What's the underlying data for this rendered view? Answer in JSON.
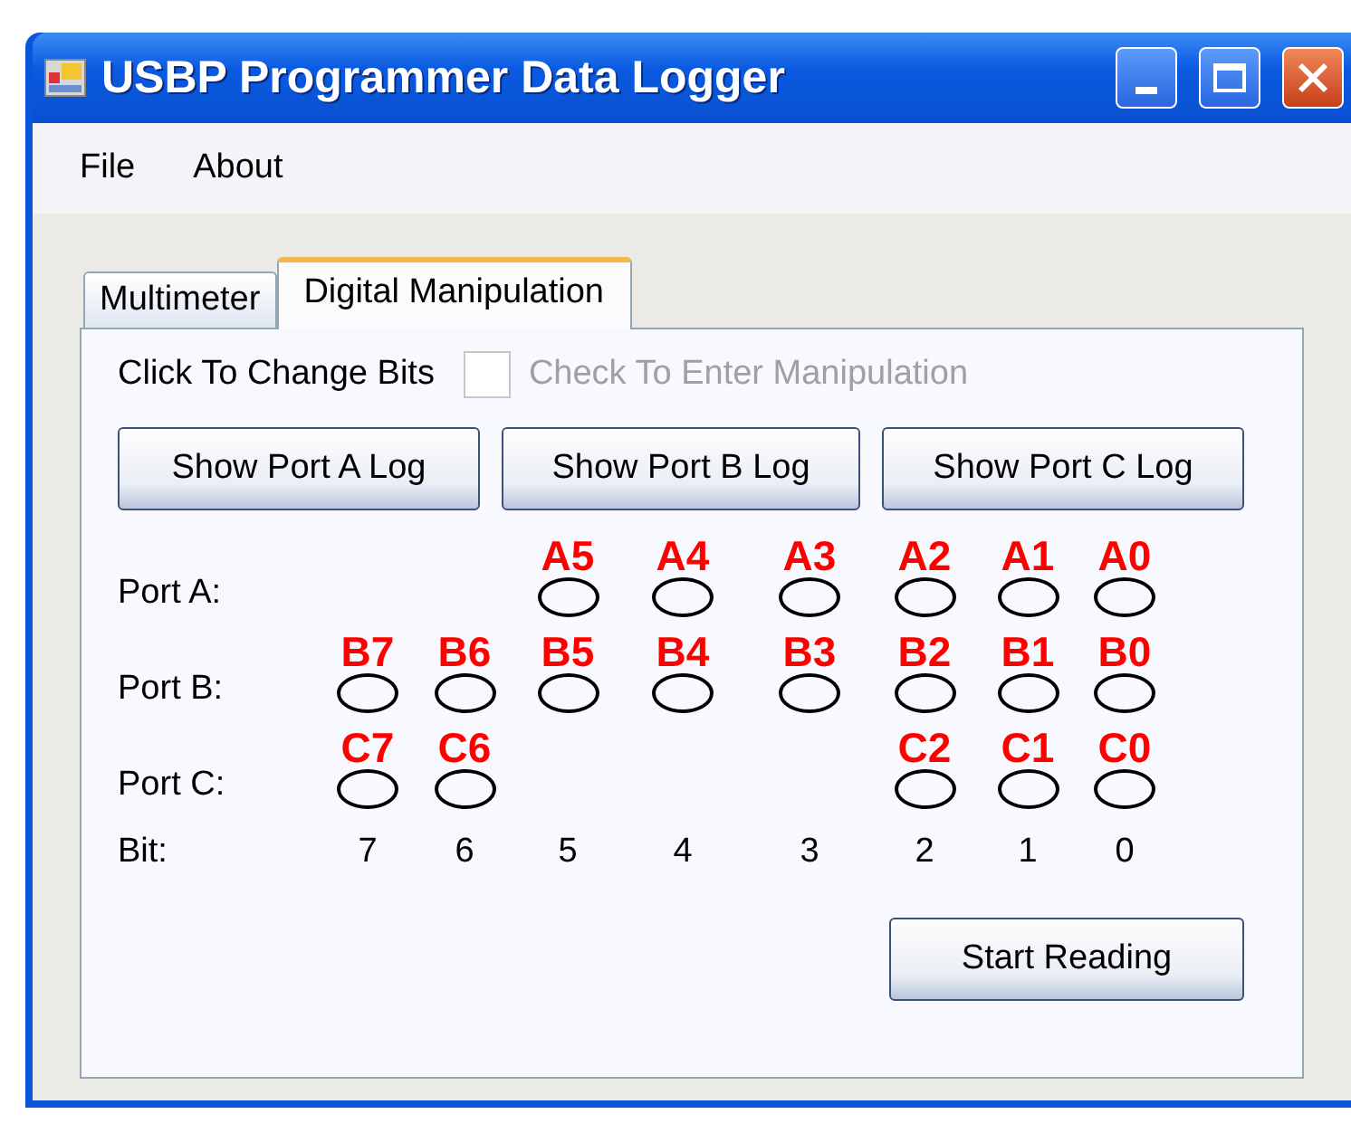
{
  "window": {
    "title": "USBP Programmer Data Logger"
  },
  "menu": [
    "File",
    "About"
  ],
  "tabs": [
    {
      "label": "Multimeter",
      "selected": false
    },
    {
      "label": "Digital Manipulation",
      "selected": true
    }
  ],
  "caption": "Click To Change Bits",
  "manipulation": {
    "label": "Check To Enter Manipulation",
    "checked": false,
    "disabled": true
  },
  "log_buttons": [
    "Show Port A Log",
    "Show Port B Log",
    "Show Port C Log"
  ],
  "ports": [
    {
      "label": "Port A:",
      "pins": [
        {
          "kind": "none"
        },
        {
          "kind": "none"
        },
        {
          "kind": "pin",
          "label": "A5",
          "on": false
        },
        {
          "kind": "pin",
          "label": "A4",
          "on": false
        },
        {
          "kind": "pin",
          "label": "A3",
          "on": false
        },
        {
          "kind": "pin",
          "label": "A2",
          "on": false
        },
        {
          "kind": "pin",
          "label": "A1",
          "on": false
        },
        {
          "kind": "pin",
          "label": "A0",
          "on": false
        }
      ]
    },
    {
      "label": "Port B:",
      "pins": [
        {
          "kind": "pin",
          "label": "B7",
          "on": false
        },
        {
          "kind": "pin",
          "label": "B6",
          "on": false
        },
        {
          "kind": "pin",
          "label": "B5",
          "on": false
        },
        {
          "kind": "pin",
          "label": "B4",
          "on": false
        },
        {
          "kind": "pin",
          "label": "B3",
          "on": false
        },
        {
          "kind": "pin",
          "label": "B2",
          "on": false
        },
        {
          "kind": "pin",
          "label": "B1",
          "on": false
        },
        {
          "kind": "pin",
          "label": "B0",
          "on": false
        }
      ]
    },
    {
      "label": "Port C:",
      "pins": [
        {
          "kind": "pin",
          "label": "C7",
          "on": false
        },
        {
          "kind": "pin",
          "label": "C6",
          "on": false
        },
        {
          "kind": "none"
        },
        {
          "kind": "none"
        },
        {
          "kind": "none"
        },
        {
          "kind": "pin",
          "label": "C2",
          "on": false
        },
        {
          "kind": "pin",
          "label": "C1",
          "on": false
        },
        {
          "kind": "pin",
          "label": "C0",
          "on": false
        }
      ]
    }
  ],
  "bit_row": {
    "label": "Bit:",
    "bits": [
      "7",
      "6",
      "5",
      "4",
      "3",
      "2",
      "1",
      "0"
    ]
  },
  "start_button": "Start Reading"
}
